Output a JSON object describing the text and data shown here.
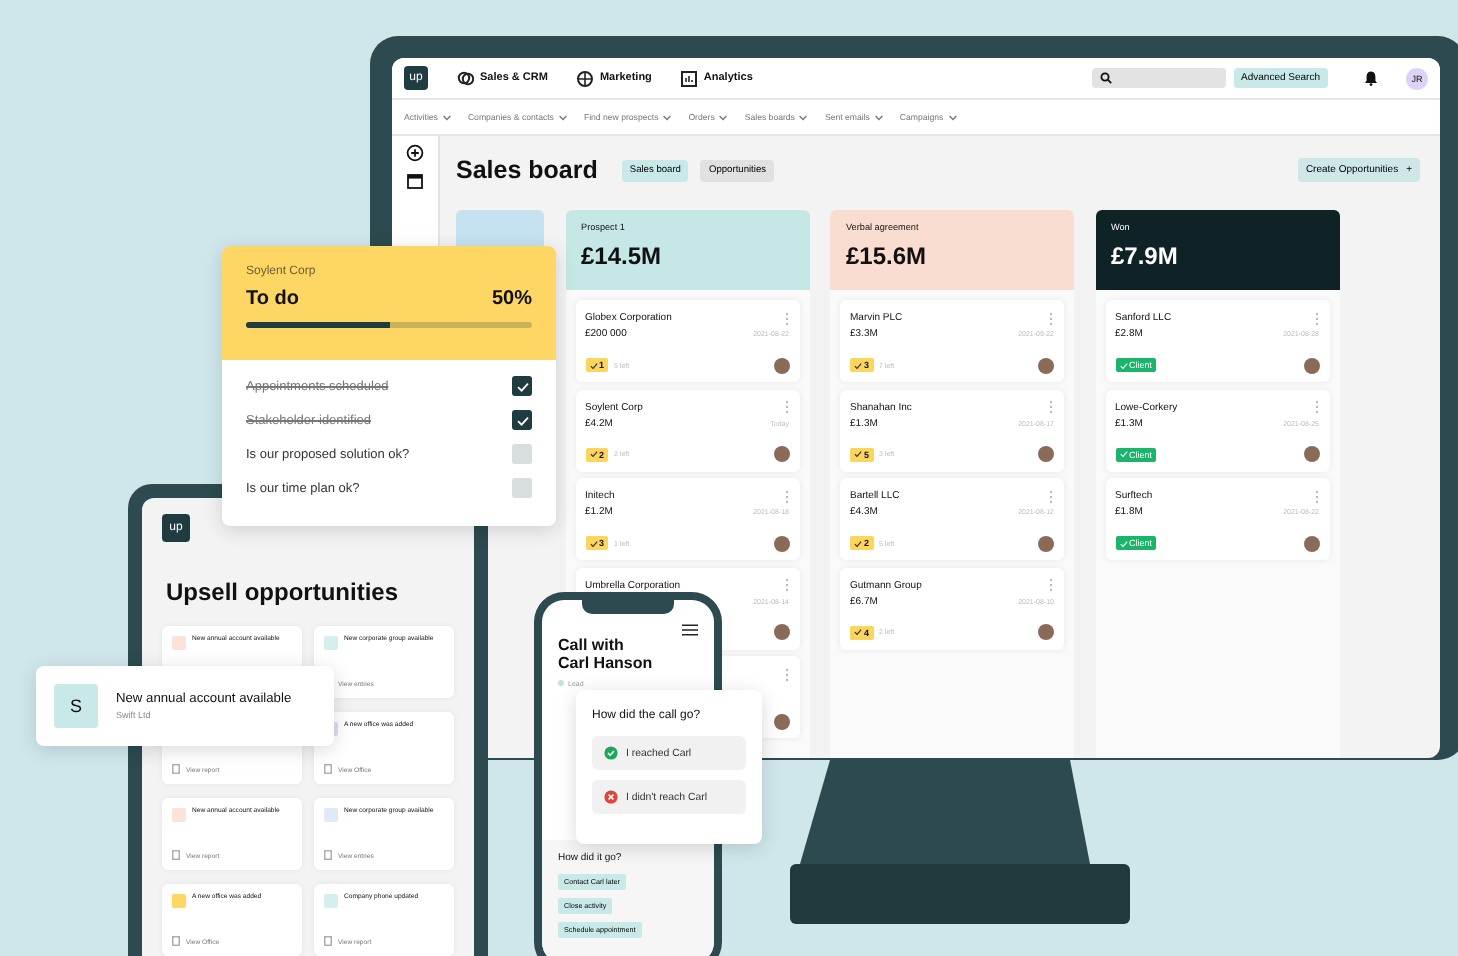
{
  "monitor": {
    "logo": "up",
    "nav": [
      "Sales & CRM",
      "Marketing",
      "Analytics"
    ],
    "search_button": "Advanced Search",
    "avatar": "JR",
    "subnav": [
      "Activities",
      "Companies & contacts",
      "Find new prospects",
      "Orders",
      "Sales boards",
      "Sent emails",
      "Campaigns"
    ],
    "title": "Sales board",
    "view_tabs": [
      {
        "label": "Sales board",
        "selected": true
      },
      {
        "label": "Opportunities",
        "selected": false
      }
    ],
    "create_button": "Create Opportunities",
    "create_icon": "+",
    "columns": [
      {
        "name": "Prospect 1",
        "total": "£14.5M",
        "color": "#c5e8e6",
        "cards": [
          {
            "kind": "task",
            "company": "Globex Corporation",
            "amount": "£200 000",
            "date": "2021-08-22",
            "tasks": "1",
            "left": "5 left"
          },
          {
            "kind": "task",
            "company": "Soylent Corp",
            "amount": "£4.2M",
            "date": "Today",
            "tasks": "2",
            "left": "2 left"
          },
          {
            "kind": "task",
            "company": "Initech",
            "amount": "£1.2M",
            "date": "2021-08-18",
            "tasks": "3",
            "left": "1 left"
          },
          {
            "kind": "task",
            "company": "Umbrella Corporation",
            "date": "2021-08-14"
          },
          {
            "kind": "task"
          }
        ]
      },
      {
        "name": "Verbal agreement",
        "total": "£15.6M",
        "color": "#f9ddd0",
        "cards": [
          {
            "kind": "task",
            "company": "Marvin PLC",
            "amount": "£3.3M",
            "date": "2021-09-22",
            "tasks": "3",
            "left": "7 left"
          },
          {
            "kind": "task",
            "company": "Shanahan Inc",
            "amount": "£1.3M",
            "date": "2021-08-17",
            "tasks": "5",
            "left": "3 left"
          },
          {
            "kind": "task",
            "company": "Bartell LLC",
            "amount": "£4.3M",
            "date": "2021-08-12",
            "tasks": "2",
            "left": "5 left"
          },
          {
            "kind": "task",
            "company": "Gutmann Group",
            "amount": "£6.7M",
            "date": "2021-08-10",
            "tasks": "4",
            "left": "2 left"
          }
        ]
      },
      {
        "name": "Won",
        "total": "£7.9M",
        "color": "#0f2226",
        "cards": [
          {
            "kind": "client",
            "company": "Sanford LLC",
            "amount": "£2.8M",
            "date": "2021-08-28",
            "badge": "Client"
          },
          {
            "kind": "client",
            "company": "Lowe-Corkery",
            "amount": "£1.3M",
            "date": "2021-08-25",
            "badge": "Client"
          },
          {
            "kind": "client",
            "company": "Surftech",
            "amount": "£1.8M",
            "date": "2021-08-22",
            "badge": "Client"
          }
        ]
      }
    ]
  },
  "todo": {
    "company": "Soylent Corp",
    "title": "To do",
    "percent": "50%",
    "level": 0.5,
    "items": [
      {
        "label": "Appointments scheduled",
        "checked": true
      },
      {
        "label": "Stakeholder identified",
        "checked": true
      },
      {
        "label": "Is our proposed solution ok?",
        "checked": false
      },
      {
        "label": "Is our time plan ok?",
        "checked": false
      }
    ]
  },
  "tablet": {
    "logo": "up",
    "title": "Upsell opportunities",
    "cards": [
      {
        "title": "New annual account available",
        "color": "#fbe3da"
      },
      {
        "title": "New corporate group available",
        "action": "View entries",
        "color": "#d6eeee"
      },
      {
        "action": "View report"
      },
      {
        "title": "A new office was added",
        "action": "View Office",
        "color": "#e3dcf5"
      },
      {
        "title": "New annual account available",
        "action": "View report",
        "color": "#fbe3da"
      },
      {
        "title": "New corporate group available",
        "action": "View entries",
        "color": "#dfe9f8"
      },
      {
        "title": "A new office was added",
        "action": "View Office",
        "color": "#fdd663"
      },
      {
        "title": "Company phone updated",
        "action": "View report",
        "color": "#d6eeee"
      }
    ]
  },
  "notification": {
    "initial": "S",
    "title": "New annual account available",
    "subtitle": "Swift Ltd"
  },
  "phone": {
    "title": "Call with Carl Hanson",
    "status": "Lead",
    "section": "How did it go?",
    "actions": [
      "Contact Carl later",
      "Close activity",
      "Schedule appointment"
    ]
  },
  "call_popup": {
    "question": "How did the call go?",
    "options": [
      {
        "kind": "reached",
        "label": "I reached Carl"
      },
      {
        "kind": "missed",
        "label": "I didn't reach Carl"
      }
    ]
  }
}
